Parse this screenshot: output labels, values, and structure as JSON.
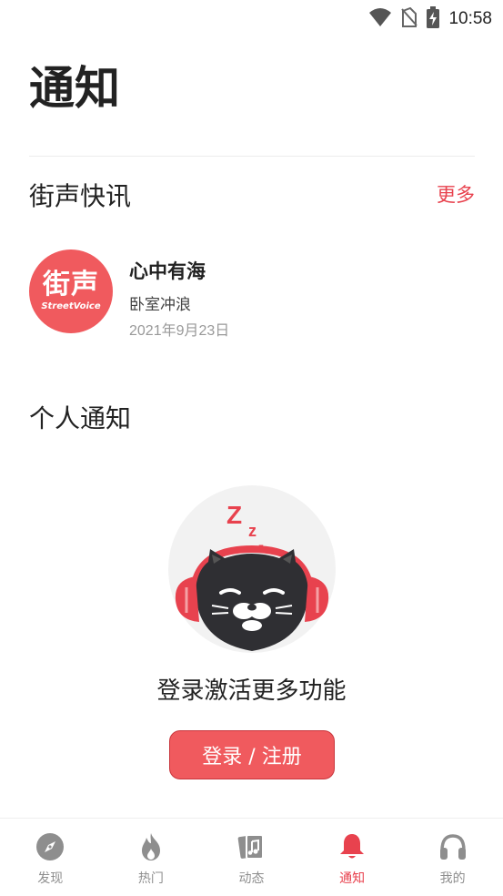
{
  "status_bar": {
    "time": "10:58"
  },
  "header": {
    "title": "通知"
  },
  "news_section": {
    "title": "街声快讯",
    "more_label": "更多",
    "item": {
      "avatar_text_cn": "街声",
      "avatar_text_en": "StreetVoice",
      "title": "心中有海",
      "subtitle": "卧室冲浪",
      "date": "2021年9月23日"
    }
  },
  "personal_section": {
    "title": "个人通知",
    "empty_text": "登录激活更多功能",
    "login_button_label": "登录 / 注册",
    "illustration_text": "Zzz"
  },
  "tab_bar": {
    "tabs": [
      {
        "label": "发现",
        "icon": "compass-icon",
        "active": false
      },
      {
        "label": "热门",
        "icon": "flame-icon",
        "active": false
      },
      {
        "label": "动态",
        "icon": "music-card-icon",
        "active": false
      },
      {
        "label": "通知",
        "icon": "bell-icon",
        "active": true
      },
      {
        "label": "我的",
        "icon": "headphones-icon",
        "active": false
      }
    ]
  },
  "colors": {
    "accent": "#e8424e",
    "brand": "#f05a5e",
    "inactive": "#8e8e8e"
  }
}
